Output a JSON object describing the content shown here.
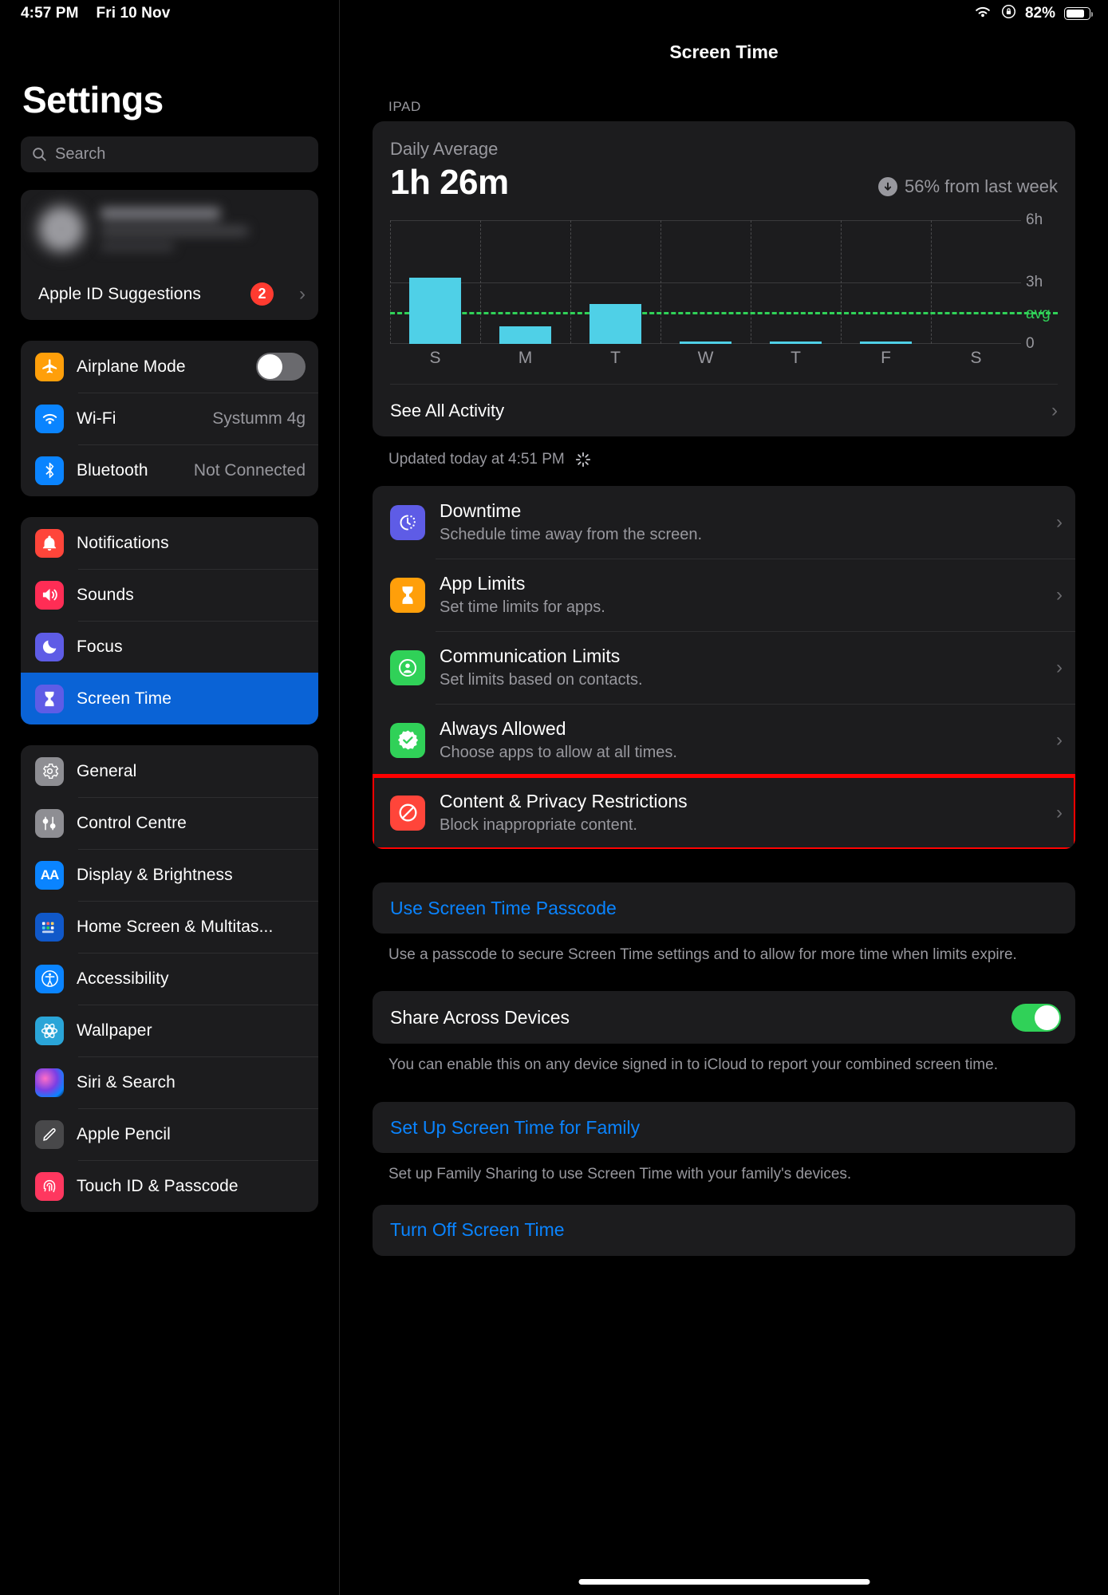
{
  "status_bar": {
    "time": "4:57 PM",
    "date": "Fri 10 Nov",
    "battery_percent": "82%",
    "wifi_icon": "wifi-icon",
    "rotation_lock_icon": "rotation-lock-icon",
    "battery_icon": "battery-icon"
  },
  "sidebar": {
    "title": "Settings",
    "search_placeholder": "Search",
    "apple_id": {
      "name_redacted": "",
      "subtitle_redacted": ""
    },
    "apple_id_suggestions": {
      "label": "Apple ID Suggestions",
      "badge": "2"
    },
    "group_connectivity": [
      {
        "label": "Airplane Mode",
        "icon": "airplane-icon",
        "value": "",
        "control": "toggle",
        "toggle_on": false
      },
      {
        "label": "Wi-Fi",
        "icon": "wifi-icon",
        "value": "Systumm 4g",
        "control": "value"
      },
      {
        "label": "Bluetooth",
        "icon": "bluetooth-icon",
        "value": "Not Connected",
        "control": "value"
      }
    ],
    "group_system": [
      {
        "label": "Notifications",
        "icon": "notifications-bell-icon",
        "selected": false
      },
      {
        "label": "Sounds",
        "icon": "sounds-speaker-icon",
        "selected": false
      },
      {
        "label": "Focus",
        "icon": "focus-moon-icon",
        "selected": false
      },
      {
        "label": "Screen Time",
        "icon": "screen-time-hourglass-icon",
        "selected": true
      }
    ],
    "group_general": [
      {
        "label": "General",
        "icon": "general-gear-icon"
      },
      {
        "label": "Control Centre",
        "icon": "control-centre-icon"
      },
      {
        "label": "Display & Brightness",
        "icon": "display-brightness-icon"
      },
      {
        "label": "Home Screen & Multitas...",
        "icon": "home-screen-icon"
      },
      {
        "label": "Accessibility",
        "icon": "accessibility-icon"
      },
      {
        "label": "Wallpaper",
        "icon": "wallpaper-icon"
      },
      {
        "label": "Siri & Search",
        "icon": "siri-icon"
      },
      {
        "label": "Apple Pencil",
        "icon": "apple-pencil-icon"
      },
      {
        "label": "Touch ID & Passcode",
        "icon": "touch-id-icon"
      }
    ]
  },
  "main": {
    "title": "Screen Time",
    "device_section_header": "IPAD",
    "summary": {
      "daily_average_label": "Daily Average",
      "daily_average_value": "1h 26m",
      "delta_text": "56% from last week",
      "delta_direction_icon": "arrow-down-circle-icon"
    },
    "see_all_activity": "See All Activity",
    "updated_text": "Updated today at 4:51 PM",
    "spinner_icon": "loading-spinner-icon",
    "features": [
      {
        "title": "Downtime",
        "subtitle": "Schedule time away from the screen.",
        "icon": "downtime-icon",
        "icon_color": "#5e5ce6",
        "highlighted": false
      },
      {
        "title": "App Limits",
        "subtitle": "Set time limits for apps.",
        "icon": "app-limits-hourglass-icon",
        "icon_color": "#ff9f0a",
        "highlighted": false
      },
      {
        "title": "Communication Limits",
        "subtitle": "Set limits based on contacts.",
        "icon": "communication-limits-icon",
        "icon_color": "#30d158",
        "highlighted": false
      },
      {
        "title": "Always Allowed",
        "subtitle": "Choose apps to allow at all times.",
        "icon": "always-allowed-check-icon",
        "icon_color": "#30d158",
        "highlighted": false
      },
      {
        "title": "Content & Privacy Restrictions",
        "subtitle": "Block inappropriate content.",
        "icon": "content-privacy-block-icon",
        "icon_color": "#ff453a",
        "highlighted": true
      }
    ],
    "passcode_button": "Use Screen Time Passcode",
    "passcode_footnote": "Use a passcode to secure Screen Time settings and to allow for more time when limits expire.",
    "share_across_devices": {
      "label": "Share Across Devices",
      "toggle_on": true
    },
    "share_footnote": "You can enable this on any device signed in to iCloud to report your combined screen time.",
    "family_button": "Set Up Screen Time for Family",
    "family_footnote": "Set up Family Sharing to use Screen Time with your family's devices.",
    "turn_off_button": "Turn Off Screen Time"
  },
  "chart_data": {
    "type": "bar",
    "title": "Daily Average",
    "categories": [
      "S",
      "M",
      "T",
      "W",
      "T",
      "F",
      "S"
    ],
    "values": [
      3.2,
      0.85,
      1.95,
      0.05,
      0.05,
      0.05,
      0.0
    ],
    "unit": "hours",
    "ylim": [
      0,
      6
    ],
    "yticks": [
      0,
      3,
      6
    ],
    "ytick_labels": [
      "0",
      "3h",
      "6h"
    ],
    "avg_label": "avg",
    "avg_value": 1.43,
    "bar_color": "#4fd0e7",
    "avg_line_color": "#30d158",
    "grid": true,
    "xlabel": "",
    "ylabel": ""
  }
}
